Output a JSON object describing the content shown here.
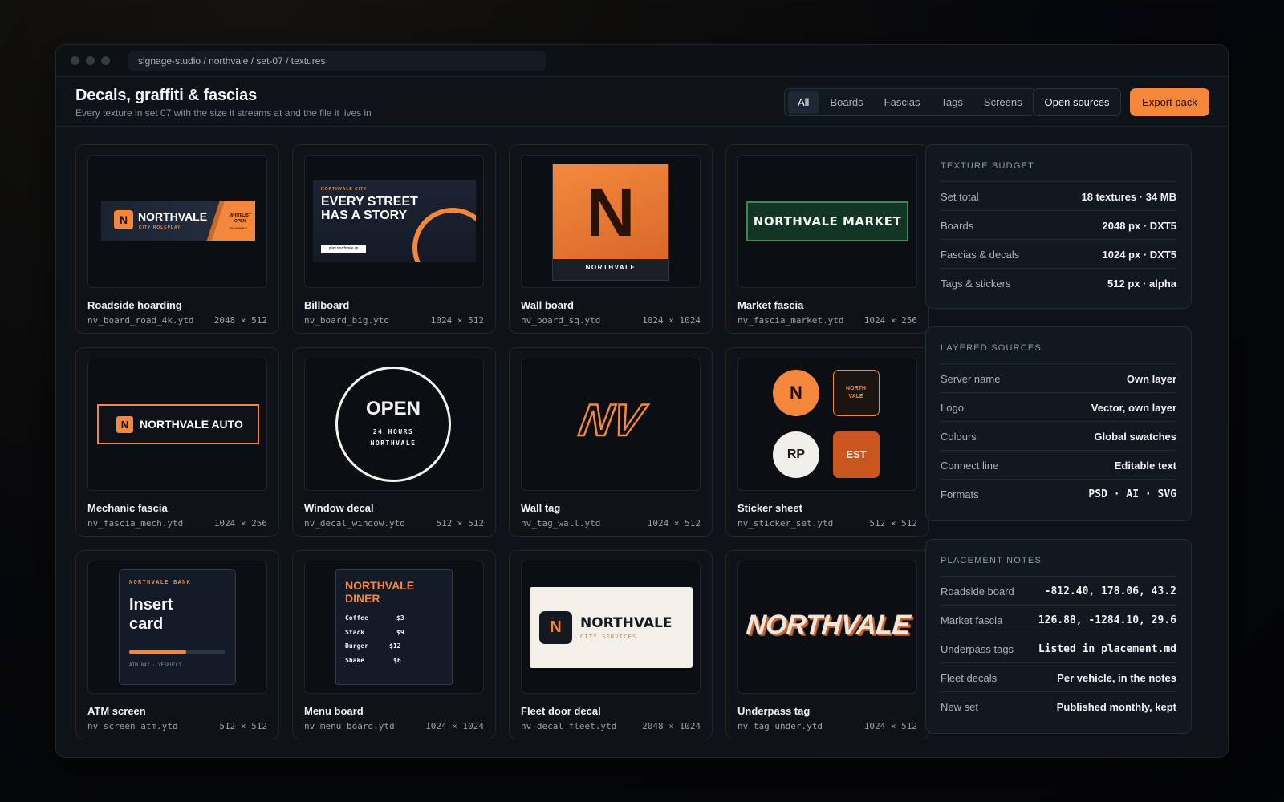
{
  "window": {
    "path": "signage-studio / northvale / set-07 / textures"
  },
  "header": {
    "title": "Decals, graffiti & fascias",
    "subtitle": "Every texture in set 07 with the size it streams at and the file it lives in",
    "filters": [
      "All",
      "Boards",
      "Fascias",
      "Tags",
      "Screens"
    ],
    "active_filter": "All",
    "open_sources_label": "Open sources",
    "export_label": "Export pack"
  },
  "cards": [
    {
      "title": "Roadside hoarding",
      "file": "nv_board_road_4k.ytd",
      "size": "2048 × 512"
    },
    {
      "title": "Billboard",
      "file": "nv_board_big.ytd",
      "size": "1024 × 512"
    },
    {
      "title": "Wall board",
      "file": "nv_board_sq.ytd",
      "size": "1024 × 1024"
    },
    {
      "title": "Market fascia",
      "file": "nv_fascia_market.ytd",
      "size": "1024 × 256"
    },
    {
      "title": "Mechanic fascia",
      "file": "nv_fascia_mech.ytd",
      "size": "1024 × 256"
    },
    {
      "title": "Window decal",
      "file": "nv_decal_window.ytd",
      "size": "512 × 512"
    },
    {
      "title": "Wall tag",
      "file": "nv_tag_wall.ytd",
      "size": "1024 × 512"
    },
    {
      "title": "Sticker sheet",
      "file": "nv_sticker_set.ytd",
      "size": "512 × 512"
    },
    {
      "title": "ATM screen",
      "file": "nv_screen_atm.ytd",
      "size": "512 × 512"
    },
    {
      "title": "Menu board",
      "file": "nv_menu_board.ytd",
      "size": "1024 × 1024"
    },
    {
      "title": "Fleet door decal",
      "file": "nv_decal_fleet.ytd",
      "size": "2048 × 1024"
    },
    {
      "title": "Underpass tag",
      "file": "nv_tag_under.ytd",
      "size": "1024 × 512"
    }
  ],
  "art": {
    "road": {
      "logo": "N",
      "name": "NORTHVALE",
      "tag": "CITY ROLEPLAY",
      "right1": "WHITELIST",
      "right2": "OPEN",
      "right3": "play.northvale.rp"
    },
    "billboard": {
      "kicker": "NORTHVALE CITY",
      "line1": "EVERY STREET",
      "line2": "HAS A STORY",
      "url": "play.northvale.rp"
    },
    "wall": {
      "letter": "N",
      "name": "NORTHVALE"
    },
    "market": {
      "text": "NORTHVALE MARKET"
    },
    "mech": {
      "logo": "N",
      "text": "NORTHVALE AUTO"
    },
    "window": {
      "big": "OPEN",
      "l1": "24 HOURS",
      "l2": "NORTHVALE"
    },
    "tag": {
      "text": "NV"
    },
    "stickers": {
      "s1": "N",
      "s2a": "NORTH",
      "s2b": "VALE",
      "s3": "RP",
      "s4": "EST"
    },
    "atm": {
      "bank": "NORTHVALE BANK",
      "l1": "Insert",
      "l2": "card",
      "progress": 0.6,
      "foot": "ATM 042 · VESPUCCI"
    },
    "menu": {
      "t1": "NORTHVALE",
      "t2": "DINER",
      "items": [
        {
          "name": "Coffee",
          "price": "$3"
        },
        {
          "name": "Stack",
          "price": "$9"
        },
        {
          "name": "Burger",
          "price": "$12"
        },
        {
          "name": "Shake",
          "price": "$6"
        }
      ]
    },
    "fleet": {
      "logo": "N",
      "name": "NORTHVALE",
      "sub": "CITY SERVICES"
    },
    "under": {
      "text": "NORTHVALE"
    }
  },
  "panels": {
    "budget": {
      "title": "TEXTURE BUDGET",
      "rows": [
        {
          "k": "Set total",
          "v": "18 textures · 34 MB"
        },
        {
          "k": "Boards",
          "v": "2048 px · DXT5"
        },
        {
          "k": "Fascias & decals",
          "v": "1024 px · DXT5"
        },
        {
          "k": "Tags & stickers",
          "v": "512 px · alpha"
        }
      ]
    },
    "sources": {
      "title": "LAYERED SOURCES",
      "rows": [
        {
          "k": "Server name",
          "v": "Own layer"
        },
        {
          "k": "Logo",
          "v": "Vector, own layer"
        },
        {
          "k": "Colours",
          "v": "Global swatches"
        },
        {
          "k": "Connect line",
          "v": "Editable text"
        },
        {
          "k": "Formats",
          "v": "PSD · AI · SVG"
        }
      ]
    },
    "placement": {
      "title": "PLACEMENT NOTES",
      "rows": [
        {
          "k": "Roadside board",
          "v": "-812.40, 178.06, 43.2"
        },
        {
          "k": "Market fascia",
          "v": "126.88, -1284.10, 29.6"
        },
        {
          "k": "Underpass tags",
          "v": "Listed in placement.md"
        },
        {
          "k": "Fleet decals",
          "v": "Per vehicle, in the notes"
        },
        {
          "k": "New set",
          "v": "Published monthly, kept"
        }
      ]
    }
  },
  "colors": {
    "accent": "#f5873c",
    "panel": "#111820",
    "bg": "#0d1319",
    "market_green": "#123524"
  }
}
